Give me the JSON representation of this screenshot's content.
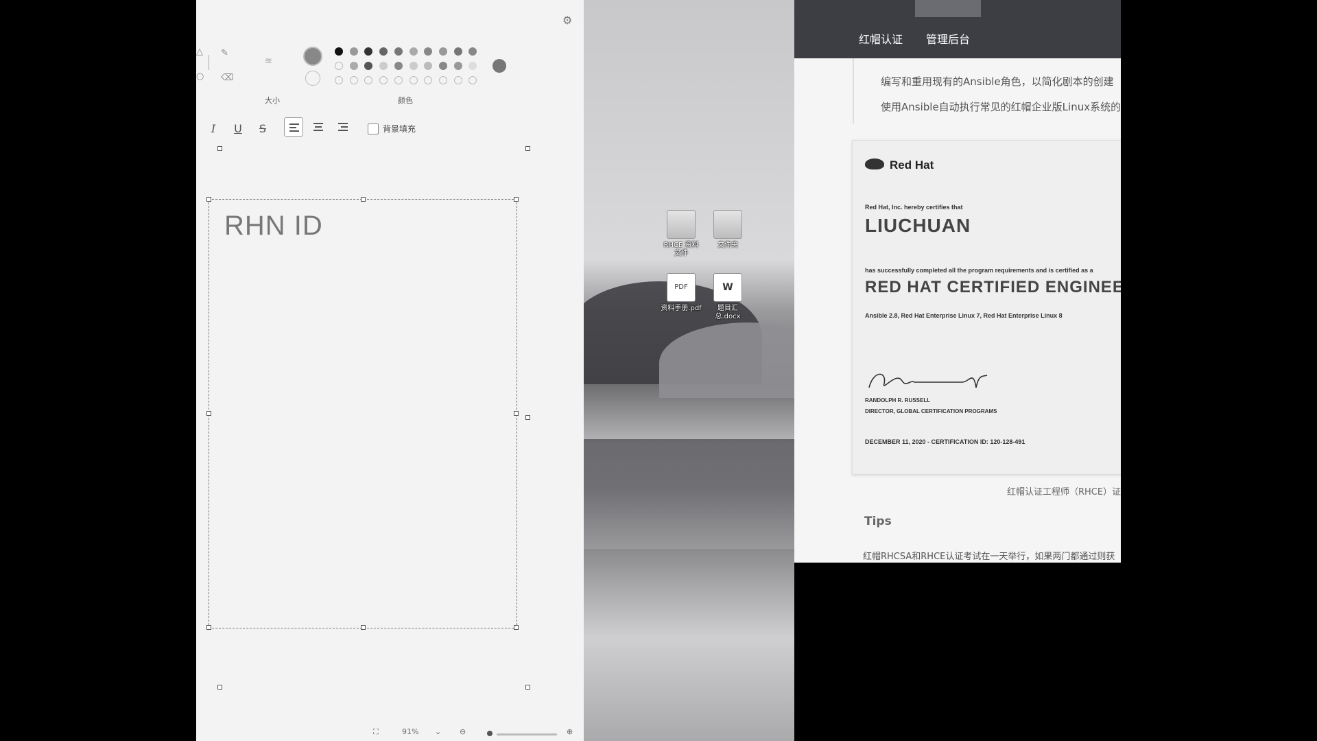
{
  "editor": {
    "size_label": "大小",
    "color_label": "颜色",
    "bg_fill_label": "背景填充",
    "textbox_text": "RHN ID",
    "zoom": "91%"
  },
  "desktop": {
    "icons": [
      {
        "caption": "RHCE 资料 文件"
      },
      {
        "caption": "文件夹"
      },
      {
        "caption": "资料手册.pdf"
      },
      {
        "caption": "题目汇总.docx"
      }
    ]
  },
  "browser": {
    "nav_items": [
      "红帽认证",
      "管理后台"
    ],
    "paragraphs": [
      "编写和重用现有的Ansible角色，以简化剧本的创建",
      "使用Ansible自动执行常见的红帽企业版Linux系统的"
    ],
    "certificate": {
      "brand": "Red Hat",
      "certifies": "Red Hat, Inc. hereby certifies that",
      "name": "LIUCHUAN",
      "completed": "has successfully completed all the program requirements and is certified as a",
      "title": "RED HAT CERTIFIED ENGINEER",
      "products": "Ansible 2.8, Red Hat Enterprise Linux 7, Red Hat Enterprise Linux 8",
      "signer_name": "RANDOLPH R. RUSSELL",
      "signer_title": "DIRECTOR, GLOBAL CERTIFICATION PROGRAMS",
      "date_id": "DECEMBER 11, 2020 - CERTIFICATION ID: 120-128-491"
    },
    "caption": "红帽认证工程师（RHCE）证书",
    "tips_heading": "Tips",
    "tips_text": "红帽RHCSA和RHCE认证考试在一天举行，如果两门都通过则获"
  }
}
